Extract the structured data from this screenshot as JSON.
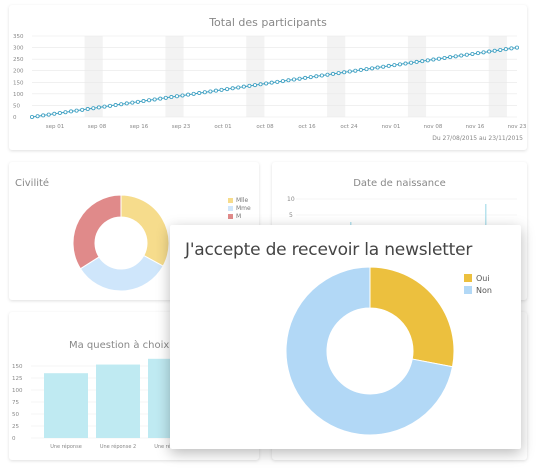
{
  "chart_data": [
    {
      "type": "line",
      "title": "Total des participants",
      "y_ticks": [
        "0",
        "50",
        "100",
        "150",
        "200",
        "250",
        "300",
        "350"
      ],
      "ylim": [
        0,
        350
      ],
      "x_tick_labels": [
        "sep 01",
        "sep 08",
        "sep 16",
        "sep 23",
        "oct 01",
        "oct 08",
        "oct 16",
        "oct 24",
        "nov 01",
        "nov 08",
        "nov 16",
        "nov 23"
      ],
      "series": [
        {
          "start": 0,
          "end": 300,
          "points": 88
        }
      ],
      "footer": "Du 27/08/2015 au 23/11/2015",
      "color": "#3a9ec1"
    },
    {
      "type": "pie",
      "title": "Civilité",
      "labels": [
        "Mlle",
        "Mme",
        "M"
      ],
      "values": [
        33,
        33,
        34
      ],
      "colors": [
        "#f6dc8c",
        "#cfe6fb",
        "#e08a8a"
      ]
    },
    {
      "type": "bar",
      "title": "Date de naissance",
      "y_ticks": [
        "10",
        "5"
      ],
      "color": "#b8e3ee"
    },
    {
      "type": "bar",
      "title": "Ma question à choix mu",
      "categories": [
        "Une réponse",
        "Une réponse 2",
        "Une réponse"
      ],
      "values": [
        135,
        153,
        165
      ],
      "y_ticks": [
        "0",
        "25",
        "50",
        "75",
        "100",
        "125",
        "150"
      ],
      "ylim": [
        0,
        175
      ],
      "color": "#bfeaf2"
    },
    {
      "type": "pie",
      "title": "J'accepte de recevoir la newsletter",
      "labels": [
        "Oui",
        "Non"
      ],
      "values": [
        28,
        72
      ],
      "colors": [
        "#ecc03e",
        "#b2d8f6"
      ]
    }
  ]
}
